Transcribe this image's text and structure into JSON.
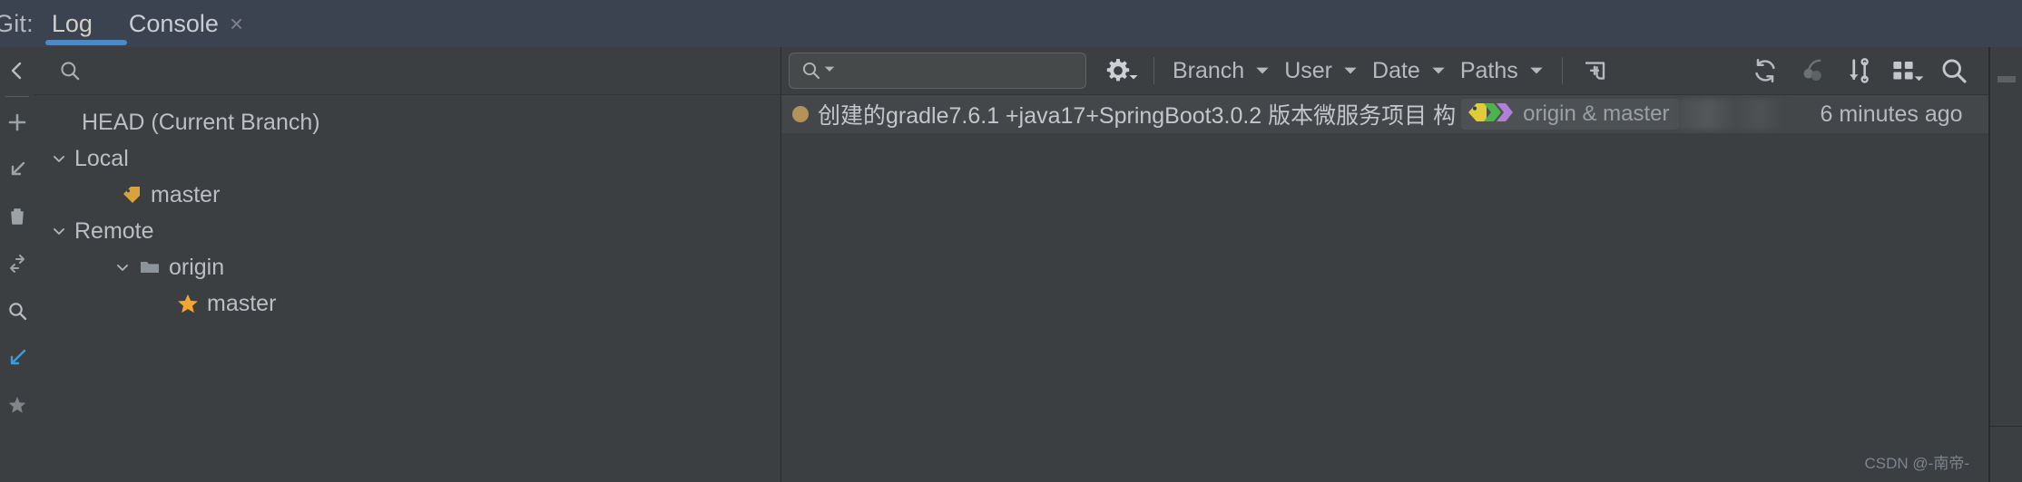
{
  "tabbar": {
    "label": "Git:",
    "tabs": [
      {
        "name": "log",
        "label": "Log",
        "active": true
      },
      {
        "name": "console",
        "label": "Console",
        "active": false
      }
    ],
    "close_glyph": "×",
    "accent_color": "#4a88c7",
    "background": "#3c4350"
  },
  "left_rail": {
    "items": [
      {
        "name": "back-icon",
        "title": "Back"
      },
      {
        "name": "add-icon",
        "title": "New Branch"
      },
      {
        "name": "checkout-icon",
        "title": "Checkout"
      },
      {
        "name": "delete-icon",
        "title": "Delete"
      },
      {
        "name": "compare-icon",
        "title": "Compare"
      },
      {
        "name": "search-icon",
        "title": "Search"
      },
      {
        "name": "rebase-icon",
        "title": "Rebase",
        "highlight_color": "#3f9bd8"
      },
      {
        "name": "favorite-icon",
        "title": "Favorites"
      }
    ]
  },
  "branch_panel": {
    "search_placeholder": "",
    "search_value": "",
    "tree": [
      {
        "label": "HEAD (Current Branch)",
        "indent": 0,
        "chevron": "",
        "icon": "none",
        "name": "tree-item-head"
      },
      {
        "label": "Local",
        "indent": 0,
        "chevron": "down",
        "icon": "none",
        "name": "tree-item-local"
      },
      {
        "label": "master",
        "indent": 1,
        "chevron": "",
        "icon": "tag",
        "name": "tree-item-local-master"
      },
      {
        "label": "Remote",
        "indent": 0,
        "chevron": "down",
        "icon": "none",
        "name": "tree-item-remote"
      },
      {
        "label": "origin",
        "indent": 1,
        "chevron": "down",
        "icon": "folder",
        "name": "tree-item-origin"
      },
      {
        "label": "master",
        "indent": 2,
        "chevron": "",
        "icon": "star",
        "name": "tree-item-origin-master"
      }
    ],
    "tag_color": "#d9a23d",
    "star_color": "#f0a732",
    "folder_color": "#8d9499"
  },
  "log_toolbar": {
    "search_value": "",
    "search_placeholder": "",
    "gear_name": "settings-gear-icon",
    "filters": [
      {
        "name": "filter-branch",
        "label": "Branch"
      },
      {
        "name": "filter-user",
        "label": "User"
      },
      {
        "name": "filter-date",
        "label": "Date"
      },
      {
        "name": "filter-paths",
        "label": "Paths"
      }
    ],
    "add_tab_name": "open-new-tab-icon",
    "right_icons": [
      {
        "name": "refresh-icon",
        "title": "Refresh"
      },
      {
        "name": "cherry-pick-icon",
        "title": "Cherry-Pick"
      },
      {
        "name": "intellisort-icon",
        "title": "IntelliSort"
      },
      {
        "name": "show-details-icon",
        "title": "Presentation Settings"
      },
      {
        "name": "search-icon",
        "title": "Find"
      }
    ]
  },
  "commits": [
    {
      "name": "commit-row",
      "dot_color": "#b59259",
      "message": "创建的gradle7.6.1 +java17+SpringBoot3.0.2 版本微服务项目 构",
      "ref_label": "origin & master",
      "ref_tag_colors": [
        "#e0cc38",
        "#4eb34e",
        "#b07fd6"
      ],
      "timestamp": "6 minutes ago",
      "selected": true
    }
  ],
  "watermark": "CSDN @-南帝-",
  "theme": {
    "background": "#3c3f41",
    "panel_border": "#2b2b2b",
    "text": "#bbbfc4",
    "muted_text": "#9aa0a6",
    "row_selected": "#434749"
  }
}
